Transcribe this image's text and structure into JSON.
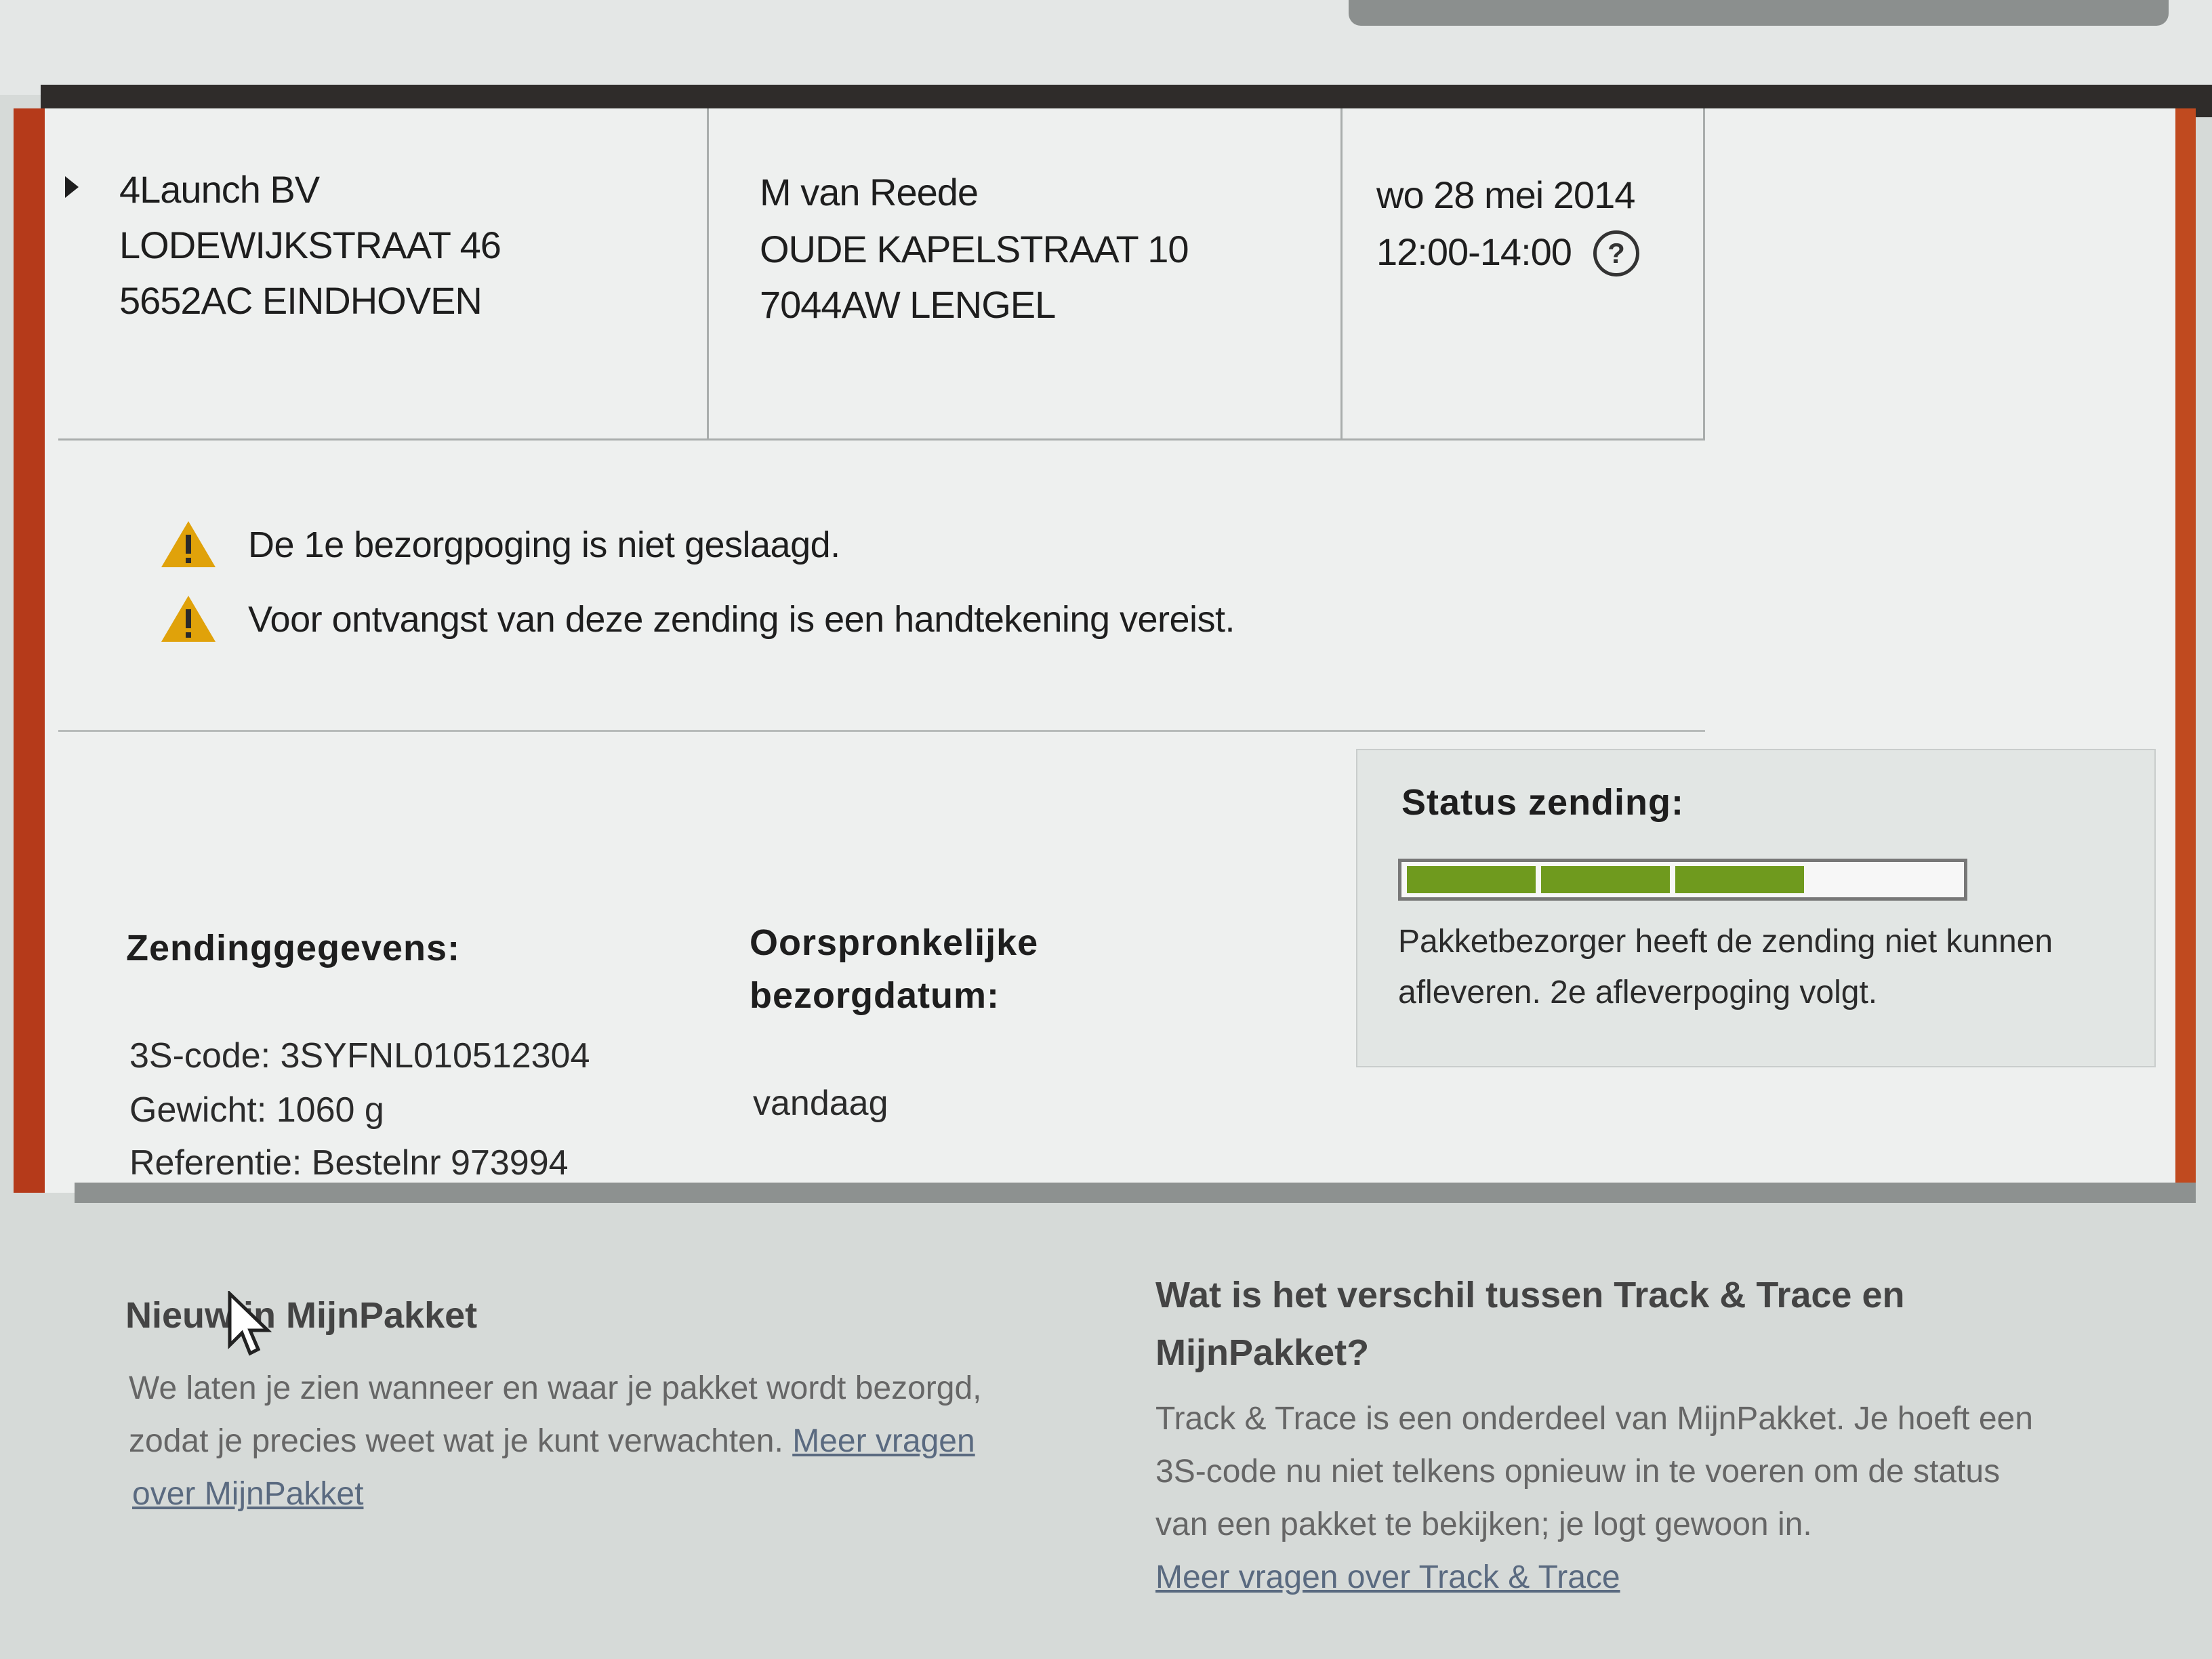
{
  "sender": {
    "name": "4Launch BV",
    "street": "LODEWIJKSTRAAT 46",
    "city": "5652AC EINDHOVEN"
  },
  "recipient": {
    "name": "M van Reede",
    "street": "OUDE KAPELSTRAAT 10",
    "city": "7044AW LENGEL"
  },
  "delivery": {
    "date": "wo 28 mei 2014",
    "time": "12:00-14:00",
    "help_symbol": "?"
  },
  "warnings": [
    {
      "icon": "warning-icon",
      "text": "De 1e bezorgpoging is niet geslaagd."
    },
    {
      "icon": "warning-icon",
      "text": "Voor ontvangst van deze zending is een handtekening vereist."
    }
  ],
  "shipment": {
    "heading": "Zendinggegevens:",
    "code": "3S-code: 3SYFNL010512304",
    "weight": "Gewicht: 1060 g",
    "reference": "Referentie: Bestelnr 973994"
  },
  "original_date": {
    "heading_line1": "Oorspronkelijke",
    "heading_line2": "bezorgdatum:",
    "value": "vandaag"
  },
  "status": {
    "heading": "Status zending:",
    "progress_segments_filled": 3,
    "progress_segments_total": 4,
    "line1": "Pakketbezorger heeft de zending niet kunnen",
    "line2": "afleveren. 2e afleverpoging volgt."
  },
  "news": {
    "title": "Nieuw in MijnPakket",
    "line1": "We laten je zien wanneer en waar je pakket wordt bezorgd,",
    "line2": "zodat je precies weet wat je kunt verwachten.",
    "link_part1": "Meer vragen",
    "link_part2": "over MijnPakket"
  },
  "faq": {
    "title_line1": "Wat is het verschil tussen Track & Trace en",
    "title_line2": "MijnPakket?",
    "line1": "Track & Trace is een onderdeel van MijnPakket. Je hoeft een",
    "line2": "3S-code nu niet telkens opnieuw in te voeren om de status",
    "line3": "van een pakket te bekijken; je logt gewoon in.",
    "link": "Meer vragen over Track & Trace"
  },
  "colors": {
    "accent_border": "#b53a1a",
    "warning": "#e0a20a",
    "progress_fill": "#6f9a1e"
  }
}
